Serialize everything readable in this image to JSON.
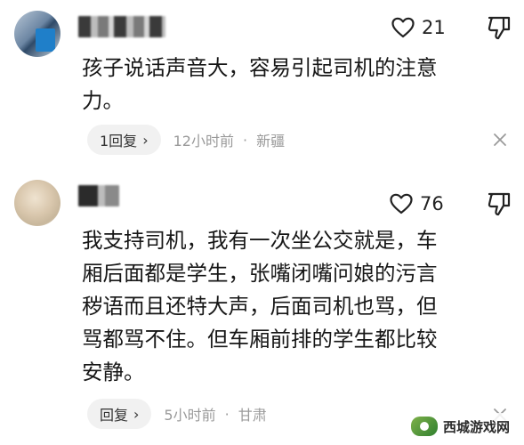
{
  "comments": [
    {
      "like_count": "21",
      "text": "孩子说话声音大，容易引起司机的注意\n力。",
      "reply_label": "1回复",
      "time": "12小时前",
      "location": "新疆"
    },
    {
      "like_count": "76",
      "text": "我支持司机，我有一次坐公交就是，车\n厢后面都是学生，张嘴闭嘴问娘的污言\n秽语而且还特大声，后面司机也骂，但\n骂都骂不住。但车厢前排的学生都比较\n安静。",
      "reply_label": "回复",
      "time": "5小时前",
      "location": "甘肃"
    }
  ],
  "separator": "·",
  "chevron": "›",
  "watermark": "西城游戏网",
  "colors": {
    "text": "#161616",
    "meta": "#9a9a9a",
    "pill": "#f1f1f1"
  },
  "icons": [
    "heart-outline-icon",
    "thumbs-down-outline-icon",
    "close-x-icon",
    "chevron-right-icon"
  ]
}
